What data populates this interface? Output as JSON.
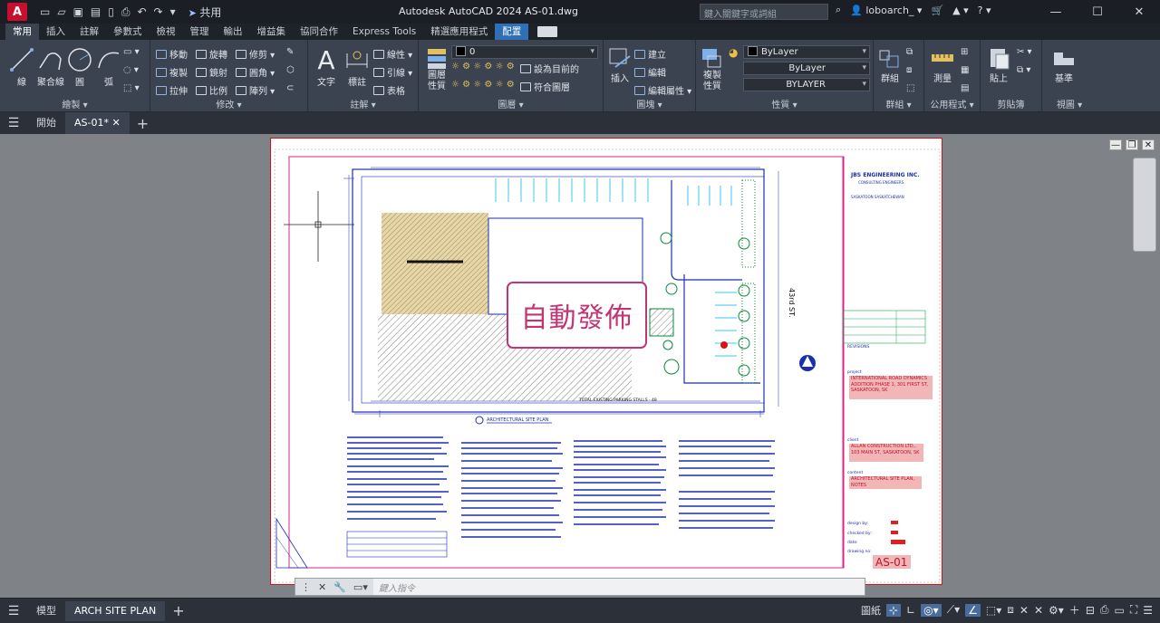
{
  "titlebar": {
    "logo": "A",
    "share": "共用",
    "title": "Autodesk AutoCAD 2024    AS-01.dwg",
    "search_placeholder": "鍵入關鍵字或詞組",
    "user": "loboarch_"
  },
  "ribbon_tabs": [
    "常用",
    "插入",
    "註解",
    "參數式",
    "檢視",
    "管理",
    "輸出",
    "增益集",
    "協同合作",
    "Express Tools",
    "精選應用程式",
    "配置"
  ],
  "ribbon": {
    "draw": {
      "title": "繪製 ▾",
      "line": "線",
      "polyline": "聚合線",
      "circle": "圓",
      "arc": "弧"
    },
    "modify": {
      "title": "修改 ▾",
      "move": "移動",
      "rotate": "旋轉",
      "trim": "修剪",
      "copy": "複製",
      "mirror": "鏡射",
      "fillet": "圓角",
      "stretch": "拉伸",
      "scale": "比例",
      "array": "陣列"
    },
    "annotation": {
      "title": "註解 ▾",
      "text": "文字",
      "dimension": "標註",
      "linear": "線性",
      "leader": "引線",
      "table": "表格"
    },
    "layers": {
      "title": "圖層 ▾",
      "props": "圖層\n性質",
      "current": "0",
      "make_current": "設為目前的",
      "match": "符合圖層"
    },
    "block": {
      "title": "圖塊 ▾",
      "insert": "插入",
      "create": "建立",
      "edit": "編輯",
      "edit_attr": "編輯屬性 ▾"
    },
    "properties": {
      "title": "性質 ▾",
      "match": "複製\n性質",
      "color": "ByLayer",
      "lineweight": "ByLayer",
      "linetype": "BYLAYER"
    },
    "groups": {
      "title": "群組 ▾",
      "group": "群組"
    },
    "utilities": {
      "title": "公用程式 ▾",
      "measure": "測量"
    },
    "clipboard": {
      "title": "剪貼簿",
      "paste": "貼上"
    },
    "view": {
      "title": "視圖 ▾",
      "base": "基準"
    }
  },
  "file_tabs": {
    "start": "開始",
    "active": "AS-01*"
  },
  "overlay": {
    "watermark": "自動發佈"
  },
  "drawing": {
    "firm": "JBS ENGINEERING INC.",
    "firm_sub": "CONSULTING ENGINEERS",
    "city": "SASKATOON      SASKATCHEWAN",
    "street": "43rd ST.",
    "plan_title": "ARCHITECTURAL SITE PLAN",
    "parking": "TOTAL EXISTING PARKING STALLS - 48",
    "revisions": "REVISIONS",
    "project_label": "project",
    "project": "INTERNATIONAL ROAD DYNAMICS ADDITION PHASE 1, 301 FIRST ST, SASKATOON, SK",
    "client_label": "client",
    "client": "ALLAN CONSTRUCTION LTD., 103 MAIN ST, SASKATOON, SK",
    "content_label": "content",
    "content": "ARCHITECTURAL SITE PLAN, NOTES",
    "design_by": "design by:",
    "checked_by": "checked by:",
    "date": "date:",
    "drawing_no": "drawing no:",
    "sheet": "AS-01"
  },
  "command": {
    "placeholder": "鍵入指令"
  },
  "statusbar": {
    "model": "模型",
    "layout": "ARCH SITE PLAN",
    "paper": "圖紙"
  }
}
